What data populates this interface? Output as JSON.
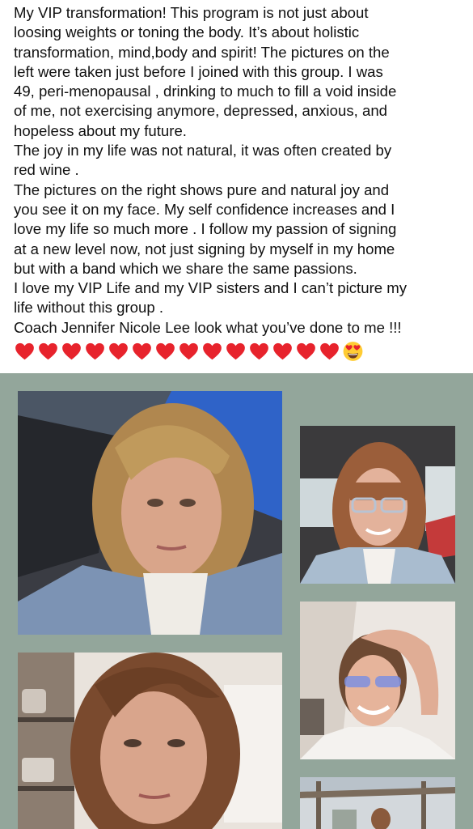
{
  "post": {
    "lines": [
      "My VIP transformation! This program is not just about",
      "loosing weights or toning the body. It’s about holistic",
      "transformation, mind,body and spirit! The pictures on the",
      "left were taken just before I joined with this group. I was",
      "49, peri-menopausal , drinking to much to fill a void inside",
      "of me, not exercising anymore, depressed, anxious, and",
      "hopeless about my future.",
      "The joy in my life was not natural, it was often created by",
      "red wine .",
      "The pictures on the right shows pure and natural joy and",
      "you see it on my face. My self confidence increases and I",
      "love my life so much more . I follow my passion of signing",
      "at a new level now, not just signing by myself in my home",
      "but with a band which we share the same passions.",
      "I love my VIP Life and my VIP sisters and I can’t picture my",
      "life without this group .",
      "Coach Jennifer Nicole Lee look what you’ve done to me !!!"
    ],
    "emoji": {
      "hearts": [
        "red-heart",
        "red-heart",
        "red-heart",
        "red-heart",
        "red-heart",
        "red-heart",
        "red-heart",
        "red-heart",
        "red-heart",
        "red-heart",
        "red-heart",
        "red-heart",
        "red-heart",
        "red-heart"
      ],
      "last": "heart-eyes-face"
    }
  },
  "collage": {
    "background": "#93a69b",
    "photos": [
      "before-selfie-in-car",
      "after-selfie-in-car-with-glasses",
      "before-selfie-in-kitchen",
      "after-selfie-smiling-hand-on-head",
      "after-photo-outdoors-partial"
    ]
  }
}
